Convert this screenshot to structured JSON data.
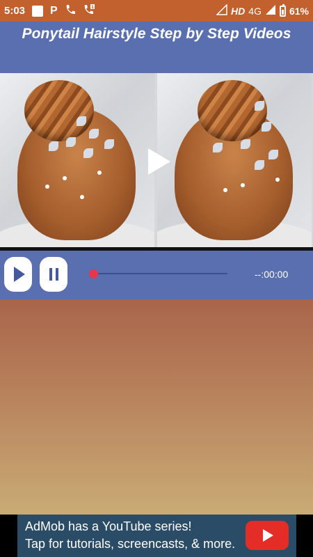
{
  "status_bar": {
    "time": "5:03",
    "network": "HD",
    "network_type": "4G",
    "battery": "61%"
  },
  "app": {
    "title": "Ponytail Hairstyle Step by Step Videos"
  },
  "player": {
    "time_display": "--:00:00",
    "progress": 0.0,
    "icons": {
      "overlay": "play-icon",
      "play_button": "play-icon",
      "pause_button": "pause-icon"
    }
  },
  "ad": {
    "line1": "AdMob has a YouTube series!",
    "line2": "Tap for tutorials, screencasts, & more.",
    "icon": "youtube-play-icon"
  },
  "colors": {
    "status_bar": "#c2612e",
    "primary": "#5a6fb0",
    "seek_thumb": "#e8364b",
    "ad_background": "#2b4c66",
    "ad_button": "#e52d27"
  }
}
